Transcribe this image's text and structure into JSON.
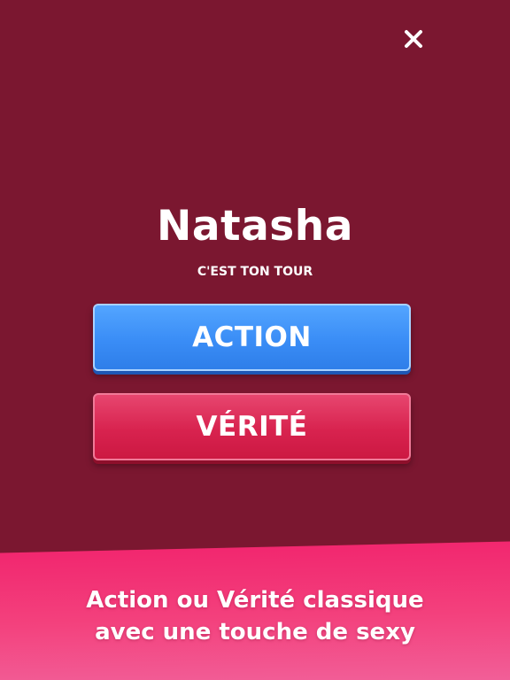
{
  "header": {
    "close_icon": "close-icon"
  },
  "turn": {
    "player_name": "Natasha",
    "label": "C'EST TON TOUR"
  },
  "choices": {
    "action_label": "ACTION",
    "truth_label": "VÉRITÉ"
  },
  "promo": {
    "line1": "Action ou Vérité classique",
    "line2": "avec une touche de sexy"
  },
  "colors": {
    "background": "#7b1730",
    "action_button": "#3a8df6",
    "truth_button": "#d8234f",
    "banner": "#f3417d",
    "text": "#ffffff"
  }
}
